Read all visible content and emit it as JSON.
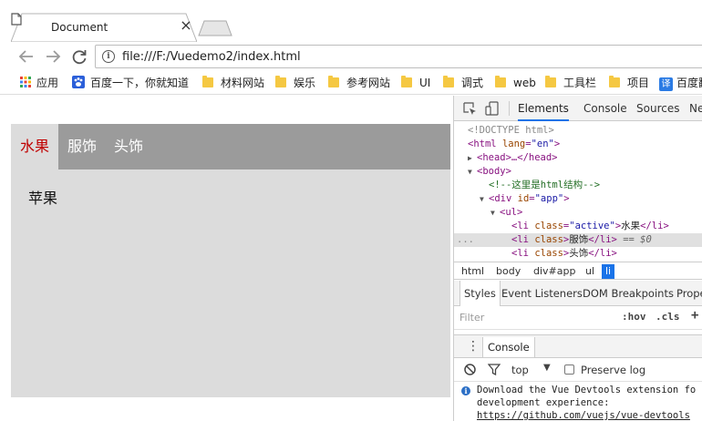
{
  "browser": {
    "tab_title": "Document",
    "tab_close": "×",
    "address": "file:///F:/Vuedemo2/index.html",
    "bookmarks": [
      {
        "label": "应用",
        "icon": "apps-grid-icon"
      },
      {
        "label": "百度一下，你就知道",
        "icon": "baidu-paw-icon"
      },
      {
        "label": "材料网站",
        "icon": "folder-icon"
      },
      {
        "label": "娱乐",
        "icon": "folder-icon"
      },
      {
        "label": "参考网站",
        "icon": "folder-icon"
      },
      {
        "label": "UI",
        "icon": "folder-icon"
      },
      {
        "label": "调式",
        "icon": "folder-icon"
      },
      {
        "label": "web",
        "icon": "folder-icon"
      },
      {
        "label": "工具栏",
        "icon": "folder-icon"
      },
      {
        "label": "项目",
        "icon": "folder-icon"
      },
      {
        "label": "百度翻",
        "icon": "translate-icon",
        "badge": "译"
      }
    ]
  },
  "page": {
    "menu": [
      {
        "label": "水果",
        "active": true
      },
      {
        "label": "服饰",
        "active": false
      },
      {
        "label": "头饰",
        "active": false
      }
    ],
    "content": "苹果",
    "colors": {
      "menu_bg": "#9b9b9b",
      "app_bg": "#dcdcdc",
      "active_text": "#c00000"
    }
  },
  "devtools": {
    "tabs": [
      "Elements",
      "Console",
      "Sources",
      "Ne"
    ],
    "active_tab": "Elements",
    "dom": {
      "doctype": "<!DOCTYPE html>",
      "html_tag": "html",
      "html_attr": "lang",
      "html_val": "\"en\"",
      "head_collapsed": "<head>…</head>",
      "body_tag": "<body>",
      "comment": "<!--这里是html结构-->",
      "div_tag": "div",
      "div_attr": "id",
      "div_val": "\"app\"",
      "ul_tag": "<ul>",
      "li_tag": "li",
      "li_attr": "class",
      "li1_val": "\"active\"",
      "li1_text": "水果",
      "li2_text": "服饰",
      "li3_text": "头饰",
      "li_close": "</li>",
      "selected_suffix": "== $0",
      "ellipsis": "..."
    },
    "breadcrumbs": [
      "html",
      "body",
      "div#app",
      "ul",
      "li"
    ],
    "styles_tabs": [
      "Styles",
      "Event Listeners",
      "DOM Breakpoints",
      "Prope"
    ],
    "filter_placeholder": "Filter",
    "filter_hov": ":hov",
    "filter_cls": ".cls",
    "filter_add": "+",
    "console_tab": "Console",
    "console_context": "top",
    "preserve_log": "Preserve log",
    "message_lines": [
      "Download the Vue Devtools extension fo",
      "development experience:",
      "https://github.com/vuejs/vue-devtools"
    ]
  }
}
